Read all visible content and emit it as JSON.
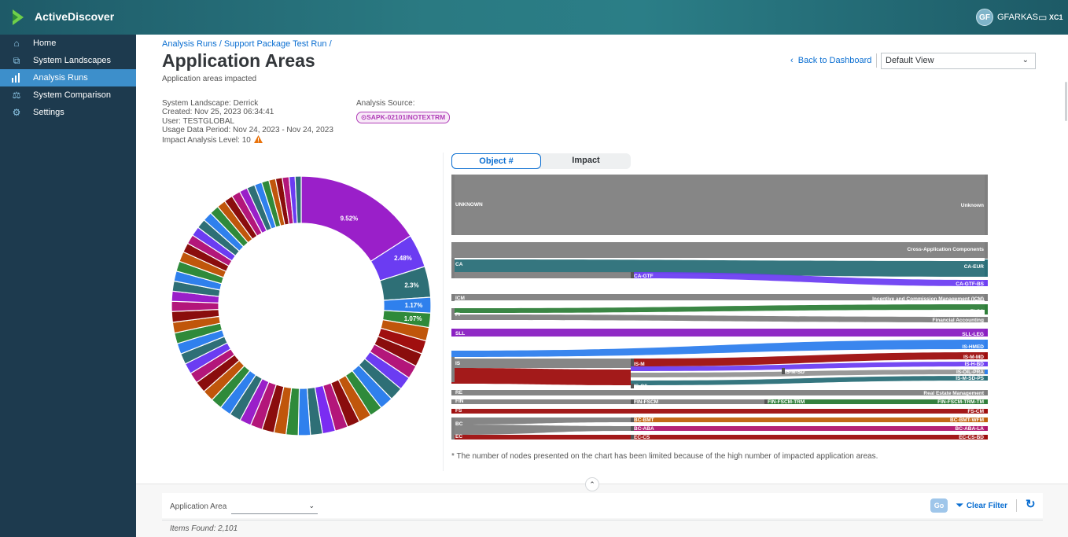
{
  "app": {
    "title": "ActiveDiscover",
    "user_initials": "GF",
    "user_name": "GFARKAS",
    "system": "XC1"
  },
  "sidebar": {
    "items": [
      {
        "label": "Home",
        "icon": "home-icon",
        "active": false
      },
      {
        "label": "System Landscapes",
        "icon": "landscape-icon",
        "active": false
      },
      {
        "label": "Analysis Runs",
        "icon": "bar-chart-icon",
        "active": true
      },
      {
        "label": "System Comparison",
        "icon": "compare-icon",
        "active": false
      },
      {
        "label": "Settings",
        "icon": "settings-icon",
        "active": false
      }
    ]
  },
  "header": {
    "breadcrumb": "Analysis Runs / Support Package Test Run /",
    "title": "Application Areas",
    "subtitle": "Application areas impacted",
    "back_label": "Back to Dashboard",
    "view_select": "Default View"
  },
  "meta": {
    "landscape": "System Landscape: Derrick",
    "created": "Created: Nov 25, 2023 06:34:41",
    "user": "User: TESTGLOBAL",
    "usage": "Usage Data Period: Nov 24, 2023 - Nov 24, 2023",
    "impact_level": "Impact Analysis Level: 10",
    "source_label": "Analysis Source:",
    "source_value": "SAPK-02101INOTEXTRM"
  },
  "toggle": {
    "left": "Object #",
    "right": "Impact",
    "selected": "Object #"
  },
  "chart_data": [
    {
      "type": "pie",
      "donut": true,
      "visible_labels": [
        "9.52%",
        "2.48%",
        "2.3%",
        "1.17%",
        "1.07%"
      ],
      "values": [
        9.52,
        2.48,
        2.3,
        1.17,
        1.07,
        1.0,
        1.0,
        1.0,
        1.0,
        1.0,
        1.0,
        1.0,
        0.95,
        0.95,
        0.95,
        0.95,
        0.95,
        0.9,
        0.9,
        0.9,
        0.9,
        0.9,
        0.9,
        0.85,
        0.85,
        0.85,
        0.85,
        0.85,
        0.85,
        0.8,
        0.8,
        0.8,
        0.8,
        0.8,
        0.8,
        0.8,
        0.75,
        0.75,
        0.75,
        0.75,
        0.75,
        0.75,
        0.7,
        0.7,
        0.7,
        0.7,
        0.7,
        0.7,
        0.65,
        0.65,
        0.65,
        0.6,
        0.6,
        0.55,
        0.55,
        0.5,
        0.5,
        0.5,
        0.45,
        0.45
      ],
      "colors": [
        "#9a1fc9",
        "#6b3cf2",
        "#2e6f76",
        "#2f80ed",
        "#2f8a3a",
        "#c0560b",
        "#a00f0f",
        "#8a0d0d",
        "#b3167a",
        "#6b3cf2",
        "#2e6f76",
        "#2f80ed",
        "#2f8a3a",
        "#c0560b",
        "#8a0d0d",
        "#b3167a",
        "#7a2cf2",
        "#2e6f76",
        "#2f80ed",
        "#2f8a3a",
        "#c0560b",
        "#8a0d0d",
        "#b3167a",
        "#9a1fc9",
        "#2e6f76",
        "#2f80ed",
        "#2f8a3a",
        "#c0560b",
        "#8a0d0d",
        "#b3167a",
        "#6b3cf2",
        "#2e6f76",
        "#2f80ed",
        "#2f8a3a",
        "#c0560b",
        "#8a0d0d",
        "#b3167a",
        "#9a1fc9",
        "#2e6f76",
        "#2f80ed",
        "#2f8a3a",
        "#c0560b",
        "#8a0d0d",
        "#b3167a",
        "#6b3cf2",
        "#2e6f76",
        "#2f80ed",
        "#2f8a3a",
        "#c0560b",
        "#8a0d0d",
        "#b3167a",
        "#9a1fc9",
        "#2e6f76",
        "#2f80ed",
        "#2f8a3a",
        "#c0560b",
        "#8a0d0d",
        "#b3167a",
        "#6b3cf2",
        "#2e6f76"
      ]
    },
    {
      "type": "sankey",
      "note": "* The number of nodes presented on the chart has been limited because of the high number of impacted application areas.",
      "source_nodes": [
        "UNKNOWN",
        "CA",
        "ICM",
        "FI",
        "SLL",
        "IS",
        "RE",
        "FIN",
        "FS",
        "BC",
        "EC"
      ],
      "target_nodes": [
        "Unknown",
        "Cross-Application Components",
        "CA-EUR",
        "CA-GTF-BS",
        "Incentive and Commission Management (ICM)",
        "FI-CA",
        "Financial Accounting",
        "SLL-LEG",
        "IS-HMED",
        "IS-M-MD",
        "IS-H-BD",
        "IS-OIL-PRA",
        "IS-M-SD-PS",
        "Real Estate Management",
        "FIN-FSCM-TRM-TM",
        "FS-CM",
        "BC-BMT-WFM",
        "BC-ABA-LA",
        "EC-CS-BD"
      ],
      "mid_nodes": [
        "CA-GTF",
        "IS-M",
        "IS-M-SD",
        "IS-OIL",
        "FIN-FSCM",
        "FIN-FSCM-TRM",
        "BC-BMT",
        "BC-ABA",
        "EC-CS"
      ]
    }
  ],
  "bottom": {
    "filter_label": "Application Area",
    "filter_value": "",
    "go_label": "Go",
    "clear_label": "Clear Filter",
    "items_found": "Items Found: 2,101"
  }
}
